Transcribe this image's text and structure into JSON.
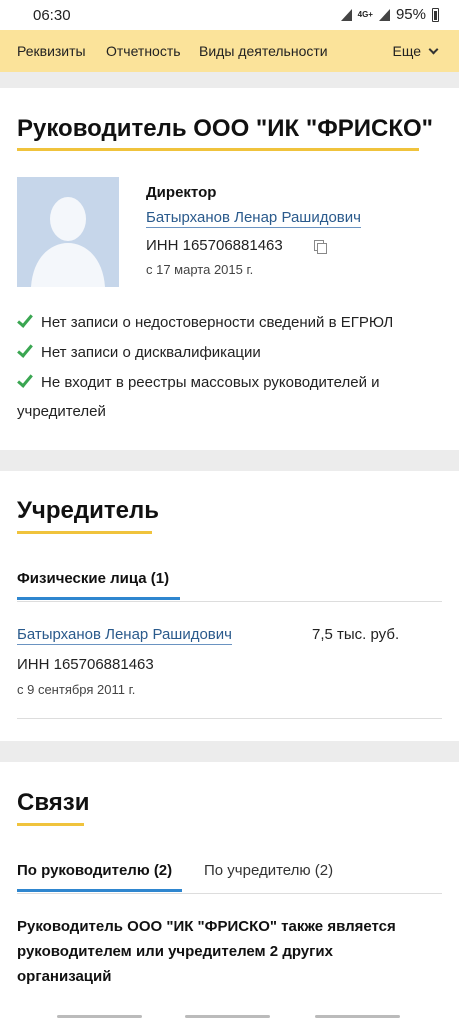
{
  "status_bar": {
    "time": "06:30",
    "network": "4G+",
    "battery": "95%"
  },
  "top_tabs": {
    "items": [
      "Реквизиты",
      "Отчетность",
      "Виды деятельности"
    ],
    "more_label": "Еще"
  },
  "head": {
    "title": "Руководитель ООО \"ИК \"ФРИСКО\"",
    "role": "Директор",
    "name": "Батырханов Ленар Рашидович",
    "inn": "ИНН 165706881463",
    "since": "с 17 марта 2015 г.",
    "checks": [
      "Нет записи о недостоверности сведений в ЕГРЮЛ",
      "Нет записи о дисквалификации",
      "Не входит в реестры массовых руководителей и учредителей"
    ]
  },
  "founder": {
    "title": "Учредитель",
    "tab_label": "Физические лица (1)",
    "name": "Батырханов Ленар Рашидович",
    "amount": "7,5 тыс. руб.",
    "inn": "ИНН 165706881463",
    "since": "с 9 сентября 2011 г."
  },
  "links": {
    "title": "Связи",
    "tab_active": "По руководителю (2)",
    "tab_other": "По учредителю (2)",
    "text": "Руководитель ООО \"ИК \"ФРИСКО\" также является руководителем или учредителем 2 других организаций"
  },
  "colors": {
    "tab_bar": "#fbe39a",
    "title_underline": "#f0c33c",
    "tab_underline": "#2f86cf",
    "link": "#2a5a8c",
    "check": "#3aa651"
  }
}
